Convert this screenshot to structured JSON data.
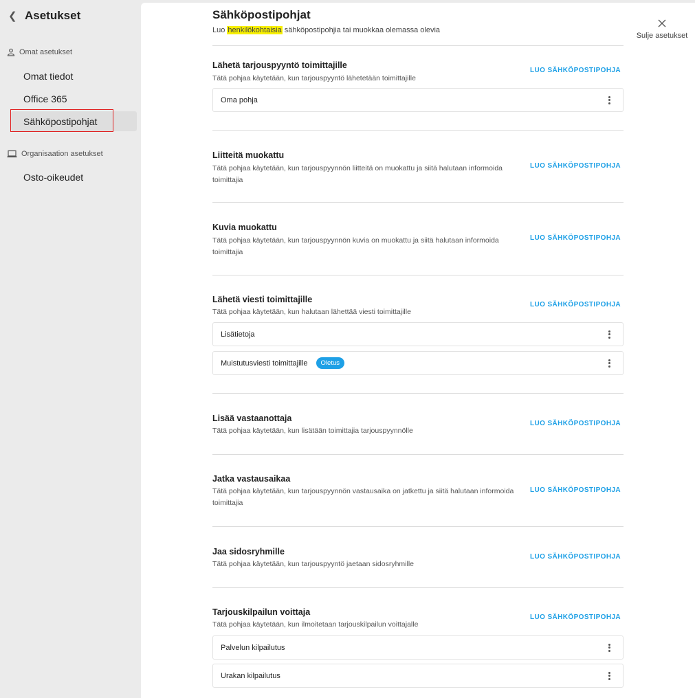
{
  "sidebar": {
    "back_icon": "chevron-left-icon",
    "title": "Asetukset",
    "sections": [
      {
        "heading": "Omat asetukset",
        "icon": "person-icon",
        "items": [
          "Omat tiedot",
          "Office 365",
          "Sähköpostipohjat"
        ]
      },
      {
        "heading": "Organisaation asetukset",
        "icon": "laptop-icon",
        "items": [
          "Osto-oikeudet"
        ]
      }
    ],
    "active_item": "Sähköpostipohjat"
  },
  "main": {
    "title": "Sähköpostipohjat",
    "subtitle": {
      "before": "Luo",
      "highlight": "henkilökohtaisia",
      "after": "sähköpostipohjia tai muokkaa olemassa olevia"
    },
    "close_label": "Sulje asetukset",
    "close_icon": "close-icon",
    "create_label": "LUO SÄHKÖPOSTIPOHJA",
    "badge_label": "Oletus",
    "sections": [
      {
        "title": "Lähetä tarjouspyyntö toimittajille",
        "desc": "Tätä pohjaa käytetään, kun tarjouspyyntö lähetetään toimittajille",
        "templates": [
          {
            "name": "Oma pohja"
          }
        ]
      },
      {
        "title": "Liitteitä muokattu",
        "desc": "Tätä pohjaa käytetään, kun tarjouspyynnön liitteitä on muokattu ja siitä halutaan informoida toimittajia",
        "templates": []
      },
      {
        "title": "Kuvia muokattu",
        "desc": "Tätä pohjaa käytetään, kun tarjouspyynnön kuvia on muokattu ja siitä halutaan informoida toimittajia",
        "templates": []
      },
      {
        "title": "Lähetä viesti toimittajille",
        "desc": "Tätä pohjaa käytetään, kun halutaan lähettää viesti toimittajille",
        "templates": [
          {
            "name": "Lisätietoja"
          },
          {
            "name": "Muistutusviesti toimittajille",
            "default": true
          }
        ]
      },
      {
        "title": "Lisää vastaanottaja",
        "desc": "Tätä pohjaa käytetään, kun lisätään toimittajia tarjouspyynnölle",
        "templates": []
      },
      {
        "title": "Jatka vastausaikaa",
        "desc": "Tätä pohjaa käytetään, kun tarjouspyynnön vastausaika on jatkettu ja siitä halutaan informoida toimittajia",
        "templates": []
      },
      {
        "title": "Jaa sidosryhmille",
        "desc": "Tätä pohjaa käytetään, kun tarjouspyyntö jaetaan sidosryhmille",
        "templates": []
      },
      {
        "title": "Tarjouskilpailun voittaja",
        "desc": "Tätä pohjaa käytetään, kun ilmoitetaan tarjouskilpailun voittajalle",
        "templates": [
          {
            "name": "Palvelun kilpailutus"
          },
          {
            "name": "Urakan kilpailutus"
          }
        ]
      }
    ]
  },
  "colors": {
    "accent": "#1ea0e6",
    "highlight": "#f7ef00",
    "sidebar_bg": "#ebebeb",
    "selection_outline": "#e02020"
  }
}
